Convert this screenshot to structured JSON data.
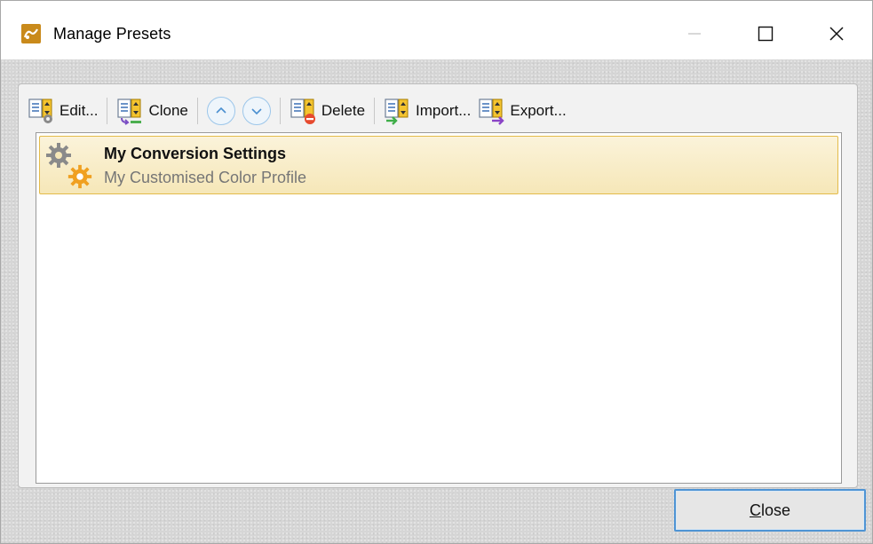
{
  "window": {
    "title": "Manage Presets",
    "controls": {
      "minimize": "minimize-icon",
      "maximize": "maximize-icon",
      "close": "close-icon"
    }
  },
  "toolbar": {
    "edit_label": "Edit...",
    "clone_label": "Clone",
    "move_up_icon": "chevron-up-icon",
    "move_down_icon": "chevron-down-icon",
    "delete_label": "Delete",
    "import_label": "Import...",
    "export_label": "Export..."
  },
  "presets": [
    {
      "title": "My Conversion Settings",
      "subtitle": "My Customised Color Profile",
      "selected": true
    }
  ],
  "footer": {
    "close_label_first": "C",
    "close_label_rest": "lose"
  },
  "colors": {
    "selection_border": "#e3bb4a",
    "selection_fill": "#f6e7b8",
    "focus_blue": "#4f94d4",
    "app_icon": "#c98a1b",
    "gear_orange": "#f0a020",
    "gear_gray": "#8a8a8a"
  }
}
